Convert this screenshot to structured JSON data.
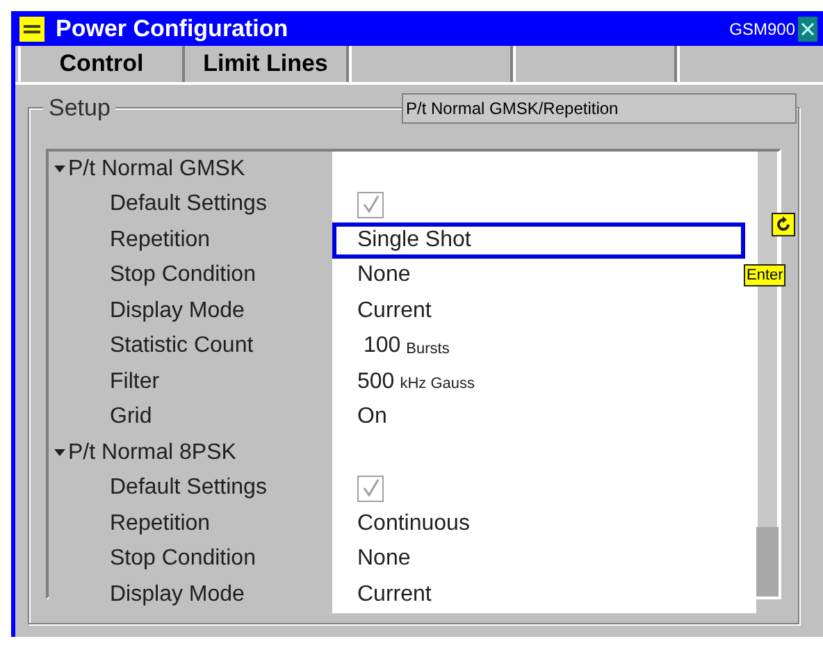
{
  "window": {
    "title": "Power Configuration",
    "mode": "GSM900"
  },
  "tabs": [
    {
      "label": "Control",
      "selected": true
    },
    {
      "label": "Limit Lines",
      "selected": false
    },
    {
      "selected": false
    },
    {
      "selected": false
    },
    {
      "selected": false
    }
  ],
  "setup": {
    "legend": "Setup",
    "path": "P/t Normal GMSK/Repetition"
  },
  "hints": {
    "enter": "Enter"
  },
  "tree": [
    {
      "label": "P/t Normal GMSK",
      "expanded": true,
      "children": [
        {
          "label": "Default Settings",
          "kind": "checkbox",
          "checked": true,
          "selected": false
        },
        {
          "label": "Repetition",
          "kind": "text",
          "value": "Single Shot",
          "selected": true
        },
        {
          "label": "Stop Condition",
          "kind": "text",
          "value": "None",
          "selected": false
        },
        {
          "label": "Display Mode",
          "kind": "text",
          "value": "Current",
          "selected": false
        },
        {
          "label": "Statistic Count",
          "kind": "text",
          "value": " 100",
          "unit": "Bursts",
          "selected": false
        },
        {
          "label": "Filter",
          "kind": "text",
          "value": "500",
          "unit": "kHz Gauss",
          "selected": false
        },
        {
          "label": "Grid",
          "kind": "text",
          "value": "On",
          "selected": false
        }
      ]
    },
    {
      "label": "P/t Normal 8PSK",
      "expanded": true,
      "children": [
        {
          "label": "Default Settings",
          "kind": "checkbox",
          "checked": true,
          "selected": false
        },
        {
          "label": "Repetition",
          "kind": "text",
          "value": "Continuous",
          "selected": false
        },
        {
          "label": "Stop Condition",
          "kind": "text",
          "value": "None",
          "selected": false
        },
        {
          "label": "Display Mode",
          "kind": "text",
          "value": "Current",
          "selected": false
        }
      ]
    }
  ]
}
